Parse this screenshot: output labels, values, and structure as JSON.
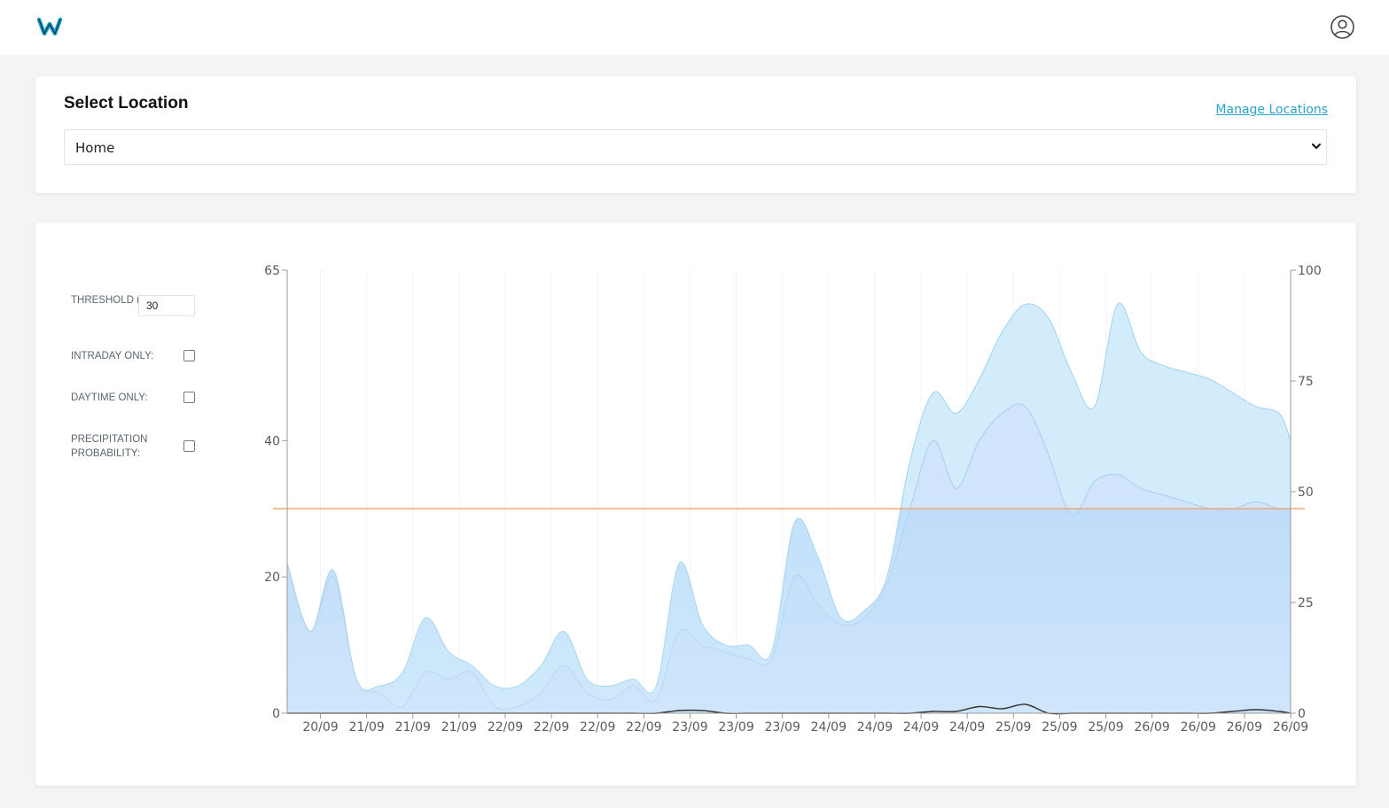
{
  "header": {
    "logo_letter": "W",
    "logo_color": "#1aa0c8",
    "user_icon": "user-circle-icon"
  },
  "location": {
    "title": "Select Location",
    "manage_link": "Manage Locations",
    "selected": "Home",
    "chevron_icon": "chevron-down-icon"
  },
  "controls": {
    "threshold_label": "THRESHOLD (KM/H):",
    "threshold_value": "30",
    "intraday_label": "INTRADAY ONLY:",
    "intraday_checked": false,
    "daytime_label": "DAYTIME ONLY:",
    "daytime_checked": false,
    "precip_label": "PRECIPITATION PROBABILITY:",
    "precip_checked": false
  },
  "colors": {
    "threshold": "#f4a064",
    "gust": "#bfe4fa",
    "wind": "#a8d2f6",
    "precip_line": "#333333",
    "accent": "#2aa3cc"
  },
  "chart_data": {
    "type": "area",
    "title": "",
    "x_ticks": [
      "20/09",
      "21/09",
      "21/09",
      "21/09",
      "22/09",
      "22/09",
      "22/09",
      "22/09",
      "23/09",
      "23/09",
      "23/09",
      "24/09",
      "24/09",
      "24/09",
      "24/09",
      "25/09",
      "25/09",
      "25/09",
      "26/09",
      "26/09",
      "26/09",
      "26/09"
    ],
    "y_left": {
      "min": 0,
      "max": 65,
      "ticks": [
        0,
        20,
        40,
        65
      ]
    },
    "y_right": {
      "min": 0,
      "max": 100,
      "ticks": [
        0,
        25,
        50,
        75,
        100
      ]
    },
    "threshold": 30,
    "x": [
      0,
      0.5,
      1,
      1.5,
      2,
      2.5,
      3,
      3.5,
      4,
      4.5,
      5,
      5.5,
      6,
      6.5,
      7,
      7.5,
      8,
      8.5,
      9,
      9.5,
      10,
      10.5,
      11,
      11.5,
      12,
      12.5,
      13,
      13.5,
      14,
      14.5,
      15,
      15.5,
      16,
      16.5,
      17,
      17.5,
      18,
      18.5,
      19,
      19.5,
      20,
      20.5,
      21,
      21.5,
      21.75
    ],
    "series": [
      {
        "axis": "left",
        "values": [
          22,
          12,
          21,
          5,
          4,
          6,
          14,
          9,
          7,
          4,
          4,
          7,
          12,
          5,
          4,
          5,
          4,
          22,
          13,
          10,
          10,
          9,
          28,
          23,
          14,
          15,
          20,
          37,
          47,
          44,
          49,
          56,
          60,
          58,
          50,
          45,
          60,
          53,
          51,
          50,
          49,
          47,
          45,
          44,
          40
        ]
      },
      {
        "axis": "left",
        "values": [
          22,
          12,
          20,
          5,
          3,
          1,
          6,
          5,
          6,
          1,
          1,
          3,
          7,
          3,
          2,
          4,
          2,
          12,
          10,
          9,
          8,
          8,
          20,
          16,
          13,
          14,
          19,
          30,
          40,
          33,
          40,
          44,
          45,
          38,
          29,
          34,
          35,
          33,
          32,
          31,
          30,
          30,
          31,
          30,
          30
        ]
      },
      {
        "axis": "right",
        "values": [
          0,
          0,
          0,
          0,
          0,
          0,
          0,
          0,
          0,
          0,
          0,
          0,
          0,
          0,
          0,
          0,
          0,
          0.6,
          0.6,
          0,
          0,
          0,
          0,
          0,
          0,
          0,
          0,
          0,
          0.4,
          0.4,
          1.5,
          1.0,
          2.0,
          0,
          0,
          0,
          0,
          0,
          0,
          0,
          0,
          0.4,
          0.8,
          0.4,
          0
        ]
      }
    ],
    "grid": false
  }
}
